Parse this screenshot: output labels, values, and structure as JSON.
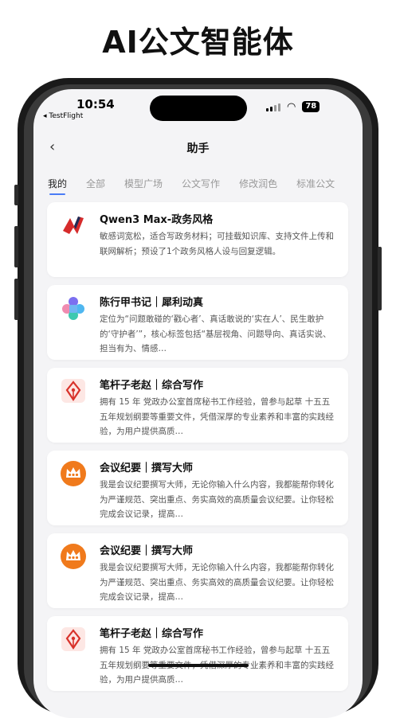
{
  "headline": "AI公文智能体",
  "status_bar": {
    "time": "10:54",
    "back_app": "◂ TestFlight",
    "battery": "78"
  },
  "nav": {
    "back_glyph": "‹",
    "title": "助手"
  },
  "tabs": [
    "我的",
    "全部",
    "模型广场",
    "公文写作",
    "修改润色",
    "标准公文"
  ],
  "cards": [
    {
      "title": "Qwen3 Max-政务风格",
      "icon": "brand-logo-icon",
      "desc": "敏感词宽松，适合写政务材料；可挂载知识库、支持文件上传和联网解析；预设了1个政务风格人设与回复逻辑。"
    },
    {
      "title": "陈行甲书记｜犀利动真",
      "icon": "puzzle-icon",
      "desc": "定位为“问题敢碰的‘戳心者’、真话敢说的‘实在人’、民生敢护的‘守护者’”，核心标签包括“基层视角、问题导向、真话实说、担当有为、情感…"
    },
    {
      "title": "笔杆子老赵｜综合写作",
      "icon": "pen-nib-icon",
      "desc": "拥有 15 年 党政办公室首席秘书工作经验，曾参与起草 十五五五年规划纲要等重要文件，凭借深厚的专业素养和丰富的实践经验，为用户提供高质…"
    },
    {
      "title": "会议纪要｜撰写大师",
      "icon": "crown-icon",
      "desc": "我是会议纪要撰写大师，无论你输入什么内容，我都能帮你转化为严谨规范、突出重点、务实高效的高质量会议纪要。让你轻松完成会议记录，提高…"
    },
    {
      "title": "会议纪要｜撰写大师",
      "icon": "crown-icon",
      "desc": "我是会议纪要撰写大师，无论你输入什么内容，我都能帮你转化为严谨规范、突出重点、务实高效的高质量会议纪要。让你轻松完成会议记录，提高…"
    },
    {
      "title": "笔杆子老赵｜综合写作",
      "icon": "pen-nib-icon",
      "desc": "拥有 15 年 党政办公室首席秘书工作经验，曾参与起草 十五五五年规划纲要等重要文件，凭借深厚的专业素养和丰富的实践经验，为用户提供高质…"
    }
  ],
  "colors": {
    "accent": "#4a7cf6",
    "crown_orange": "#f07a1c",
    "pen_red": "#d8322a",
    "logo_red": "#d62b2b"
  }
}
